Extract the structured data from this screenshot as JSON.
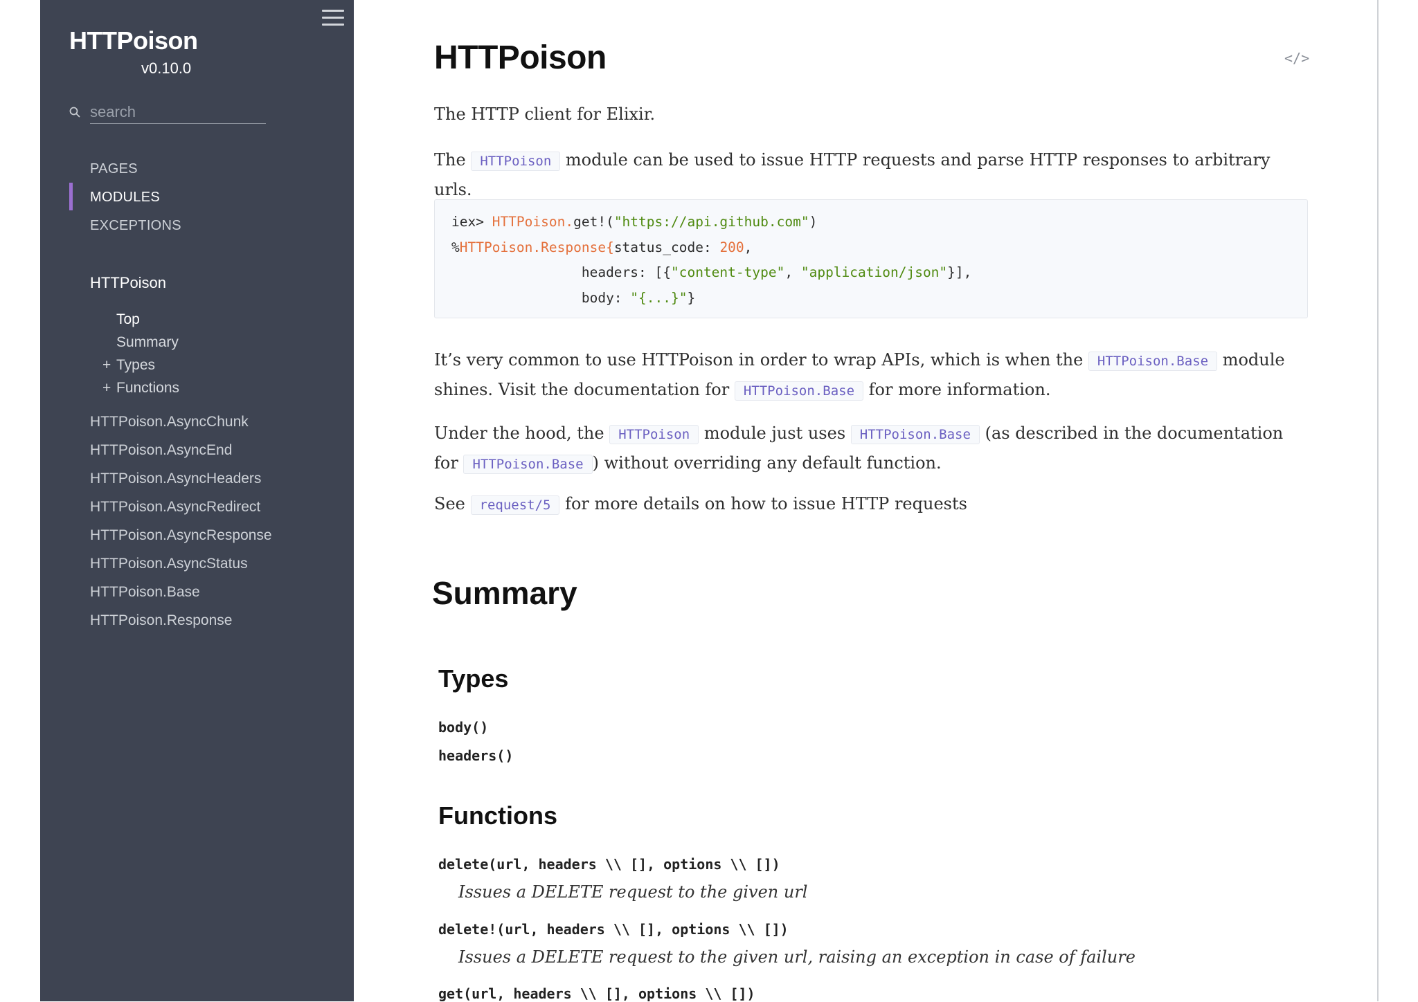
{
  "sidebar": {
    "project": "HTTPoison",
    "version": "v0.10.0",
    "search_placeholder": "search",
    "tabs": [
      "PAGES",
      "MODULES",
      "EXCEPTIONS"
    ],
    "active_tab": "MODULES",
    "current_module": "HTTPoison",
    "sub_items": [
      "Top",
      "Summary",
      "Types",
      "Functions"
    ],
    "expand_symbol": "+",
    "modules": [
      "HTTPoison.AsyncChunk",
      "HTTPoison.AsyncEnd",
      "HTTPoison.AsyncHeaders",
      "HTTPoison.AsyncRedirect",
      "HTTPoison.AsyncResponse",
      "HTTPoison.AsyncStatus",
      "HTTPoison.Base",
      "HTTPoison.Response"
    ],
    "accent_color": "#9b6fd1"
  },
  "content": {
    "title": "HTTPoison",
    "source_link": "</>",
    "intro": "The HTTP client for Elixir.",
    "p2": {
      "a": "The",
      "code": "HTTPoison",
      "b": "module can be used to issue HTTP requests and parse HTTP responses to arbitrary urls."
    },
    "code_example": {
      "l1_prompt": "iex> ",
      "l1_mod": "HTTPoison.",
      "l1_fn": "get!(",
      "l1_str": "\"https://api.github.com\"",
      "l1_end": ")",
      "l2_pct": "%",
      "l2_mod": "HTTPoison.Response{",
      "l2_key": "status_code: ",
      "l2_num": "200",
      "l2_end": ",",
      "l3_pad": "                ",
      "l3_key": "headers: [{",
      "l3_s1": "\"content-type\"",
      "l3_sep": ", ",
      "l3_s2": "\"application/json\"",
      "l3_end": "}],",
      "l4_pad": "                ",
      "l4_key": "body: ",
      "l4_str": "\"{...}\"",
      "l4_end": "}"
    },
    "p3": {
      "a": "It’s very common to use HTTPoison in order to wrap APIs, which is when the",
      "code1": "HTTPoison.Base",
      "b": "module shines. Visit the documentation for",
      "code2": "HTTPoison.Base",
      "c": "for more information."
    },
    "p4": {
      "a": "Under the hood, the",
      "code1": "HTTPoison",
      "b": "module just uses",
      "code2": "HTTPoison.Base",
      "c": "(as described in the documentation for",
      "code3": "HTTPoison.Base",
      "d": ") without overriding any default function."
    },
    "p5": {
      "a": "See",
      "code": "request/5",
      "b": "for more details on how to issue HTTP requests"
    },
    "summary_heading": "Summary",
    "types_heading": "Types",
    "types": [
      "body()",
      "headers()"
    ],
    "functions_heading": "Functions",
    "functions": [
      {
        "sig": "delete(url, headers \\\\ [], options \\\\ [])",
        "doc": "Issues a DELETE request to the given url"
      },
      {
        "sig": "delete!(url, headers \\\\ [], options \\\\ [])",
        "doc": "Issues a DELETE request to the given url, raising an exception in case of failure"
      },
      {
        "sig": "get(url, headers \\\\ [], options \\\\ [])",
        "doc": ""
      }
    ]
  }
}
